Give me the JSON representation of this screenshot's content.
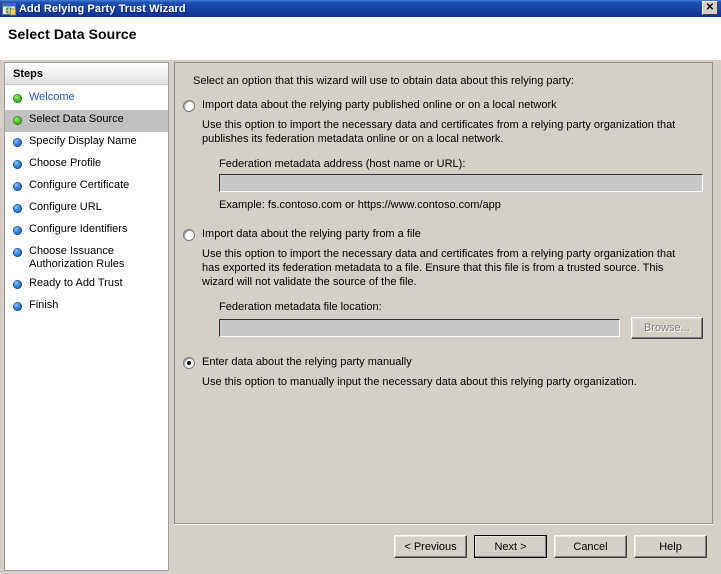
{
  "window": {
    "title": "Add Relying Party Trust Wizard",
    "icon": "wizard-window-icon",
    "close_label": "✕",
    "header_title": "Select Data Source"
  },
  "sidebar": {
    "header": "Steps",
    "items": [
      {
        "label": "Welcome",
        "bullet": "green",
        "state": "completed"
      },
      {
        "label": "Select Data Source",
        "bullet": "green",
        "state": "current"
      },
      {
        "label": "Specify Display Name",
        "bullet": "blue",
        "state": "pending"
      },
      {
        "label": "Choose Profile",
        "bullet": "blue",
        "state": "pending"
      },
      {
        "label": "Configure Certificate",
        "bullet": "blue",
        "state": "pending"
      },
      {
        "label": "Configure URL",
        "bullet": "blue",
        "state": "pending"
      },
      {
        "label": "Configure Identifiers",
        "bullet": "blue",
        "state": "pending"
      },
      {
        "label": "Choose Issuance Authorization Rules",
        "bullet": "blue",
        "state": "pending"
      },
      {
        "label": "Ready to Add Trust",
        "bullet": "blue",
        "state": "pending"
      },
      {
        "label": "Finish",
        "bullet": "blue",
        "state": "pending"
      }
    ]
  },
  "main": {
    "intro": "Select an option that this wizard will use to obtain data about this relying party:",
    "options": [
      {
        "label": "Import data about the relying party published online or on a local network",
        "selected": false,
        "description": "Use this option to import the necessary data and certificates from a relying party organization that publishes its federation metadata online or on a local network.",
        "field_label": "Federation metadata address (host name or URL):",
        "field_value": "",
        "field_placeholder": "",
        "example": "Example: fs.contoso.com or https://www.contoso.com/app"
      },
      {
        "label": "Import data about the relying party from a file",
        "selected": false,
        "description": "Use this option to import the necessary data and certificates from a relying party organization that has exported its federation metadata to a file. Ensure that this file is from a trusted source.  This wizard will not validate the source of the file.",
        "field_label": "Federation metadata file location:",
        "field_value": "",
        "field_placeholder": "",
        "browse_label": "Browse...",
        "browse_enabled": false
      },
      {
        "label": "Enter data about the relying party manually",
        "selected": true,
        "description": "Use this option to manually input the necessary data about this relying party organization."
      }
    ]
  },
  "footer": {
    "buttons": [
      {
        "label": "< Previous",
        "default": false
      },
      {
        "label": "Next >",
        "default": true
      },
      {
        "label": "Cancel",
        "default": false
      },
      {
        "label": "Help",
        "default": false
      }
    ]
  },
  "colors": {
    "titlebar": "#12399a",
    "dialog_face": "#d4d0c8",
    "step_current_bg": "#c0c0c0",
    "step_link": "#2255cc",
    "bullet_green": "#52c02a",
    "bullet_blue": "#2f7fd8"
  }
}
